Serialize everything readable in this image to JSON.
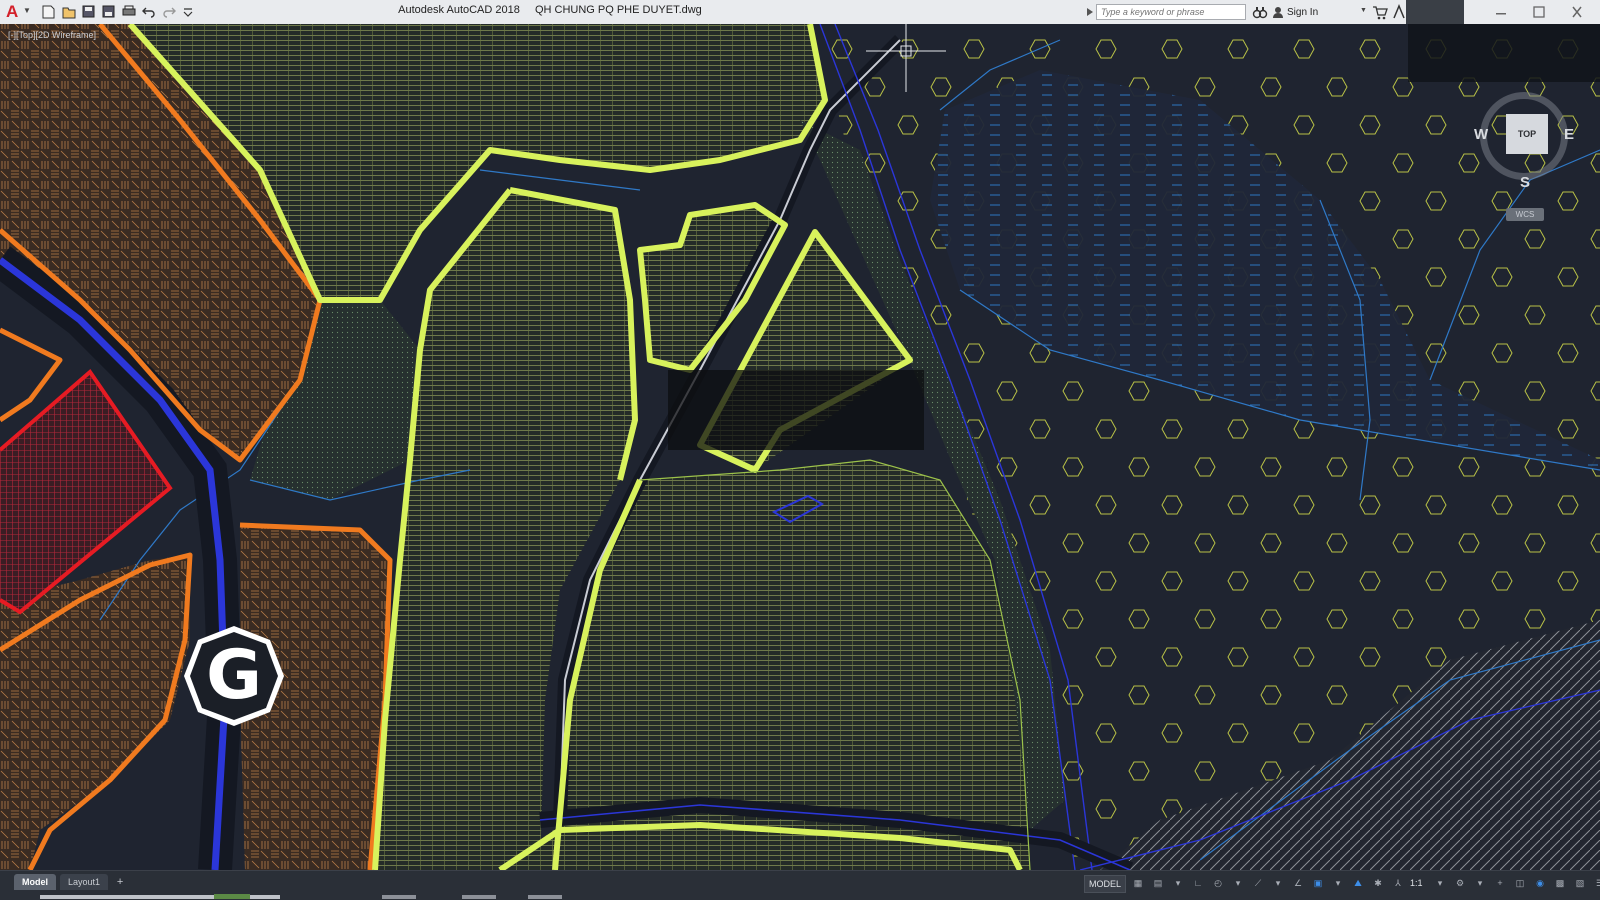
{
  "titlebar": {
    "app_name": "Autodesk AutoCAD 2018",
    "file_name": "QH CHUNG PQ PHE DUYET.dwg",
    "search_placeholder": "Type a keyword or phrase",
    "signin_label": "Sign In",
    "quick_access": [
      "new-icon",
      "open-icon",
      "save-icon",
      "save-as-icon",
      "plot-icon",
      "undo-icon",
      "redo-icon",
      "customize-icon"
    ]
  },
  "viewport": {
    "label": "[-][Top][2D Wireframe]",
    "viewcube": {
      "top": "TOP",
      "west": "W",
      "east": "E",
      "south": "S",
      "wcs": "WCS"
    },
    "grid_marker": "G"
  },
  "statusbar": {
    "tabs": [
      "Model",
      "Layout1"
    ],
    "add_tab": "+",
    "model_button": "MODEL",
    "scale": "1:1"
  },
  "colors": {
    "background": "#1f2430",
    "zone_lime": "#d8f25c",
    "zone_orange": "#f07a1f",
    "zone_red": "#e61b23",
    "road": "#2b36d9",
    "water_blue": "#2f79c7",
    "hex_yellow": "#b9c246"
  }
}
